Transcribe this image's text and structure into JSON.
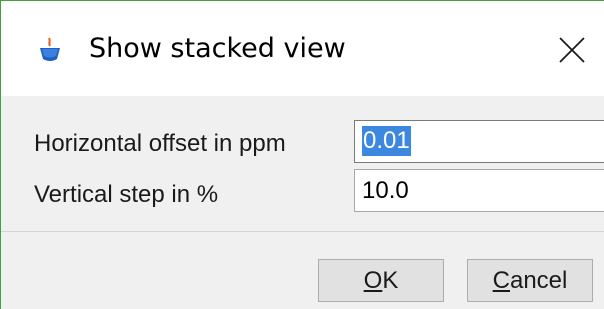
{
  "window": {
    "title": "Show stacked view",
    "app_icon": "java-coffee-cup-icon",
    "close_icon": "close-icon",
    "accent_color": "#3fa13a"
  },
  "form": {
    "horizontal_offset": {
      "label": "Horizontal offset in ppm",
      "value": "0.01",
      "selected": true
    },
    "vertical_step": {
      "label": "Vertical step in %",
      "value": "10.0"
    }
  },
  "buttons": {
    "ok": {
      "mnemonic": "O",
      "rest": "K"
    },
    "cancel": {
      "mnemonic": "C",
      "rest": "ancel"
    }
  },
  "colors": {
    "selection": "#3c87e0",
    "button_face": "#e1e1e1",
    "dialog_bg": "#f0f0f0"
  }
}
